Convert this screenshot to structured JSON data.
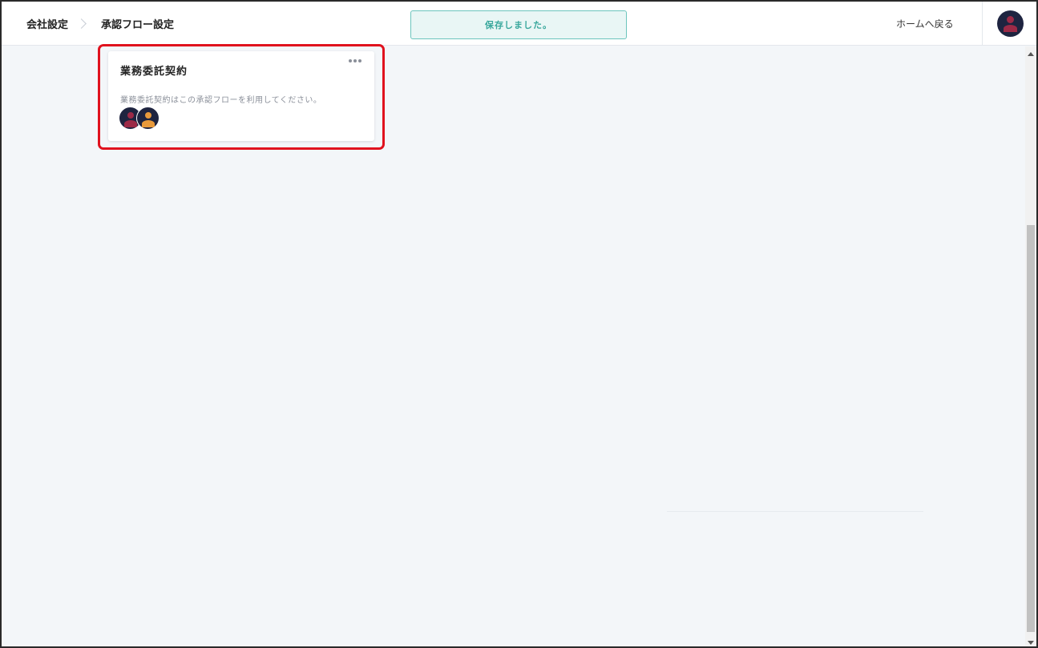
{
  "header": {
    "breadcrumb": [
      "会社設定",
      "承認フロー設定"
    ],
    "toast": "保存しました。",
    "home_link": "ホームへ戻る"
  },
  "card": {
    "title": "業務委託契約",
    "description": "業務委託契約はこの承認フローを利用してください。",
    "menu_icon": "more-horizontal-icon",
    "avatar_colors": [
      "#9c2a47",
      "#e89a3c"
    ]
  },
  "colors": {
    "highlight": "#e0121e",
    "toast_border": "#6cc5bd",
    "toast_text": "#3aa89d",
    "background": "#f3f6f9"
  }
}
